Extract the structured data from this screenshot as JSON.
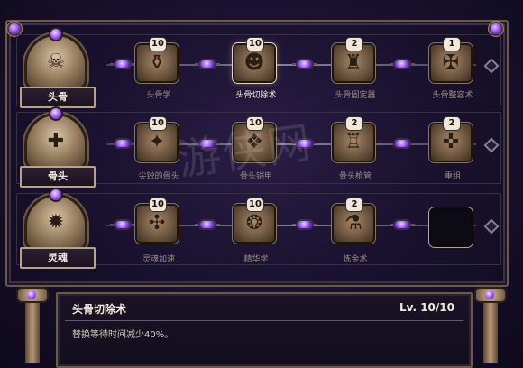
{
  "categories": [
    {
      "label": "头骨",
      "icon": "skull-icon"
    },
    {
      "label": "骨头",
      "icon": "bone-icon"
    },
    {
      "label": "灵魂",
      "icon": "soul-icon"
    }
  ],
  "rows": [
    [
      {
        "name": "头骨学",
        "level": "10",
        "icon": "skull-study-icon",
        "active": false
      },
      {
        "name": "头骨切除术",
        "level": "10",
        "icon": "skull-excision-icon",
        "active": true
      },
      {
        "name": "头骨固定器",
        "level": "2",
        "icon": "skull-fixer-icon",
        "active": false
      },
      {
        "name": "头骨整容术",
        "level": "1",
        "icon": "skull-cosmetic-icon",
        "active": false
      }
    ],
    [
      {
        "name": "尖锐的骨头",
        "level": "10",
        "icon": "sharp-bone-icon",
        "active": false
      },
      {
        "name": "骨头铠甲",
        "level": "10",
        "icon": "bone-armor-icon",
        "active": false
      },
      {
        "name": "骨头枪管",
        "level": "2",
        "icon": "bone-barrel-icon",
        "active": false
      },
      {
        "name": "重组",
        "level": "2",
        "icon": "recombine-icon",
        "active": false
      }
    ],
    [
      {
        "name": "灵魂加速",
        "level": "10",
        "icon": "soul-accel-icon",
        "active": false
      },
      {
        "name": "精华学",
        "level": "10",
        "icon": "essence-icon",
        "active": false
      },
      {
        "name": "炼金术",
        "level": "2",
        "icon": "alchemy-icon",
        "active": false
      },
      {
        "name": "",
        "level": "",
        "icon": "empty-slot-icon",
        "active": false,
        "empty": true
      }
    ]
  ],
  "detail": {
    "title": "头骨切除术",
    "level": "Lv. 10/10",
    "description": "替换等待时间减少40%。"
  },
  "watermark": "游侠网"
}
